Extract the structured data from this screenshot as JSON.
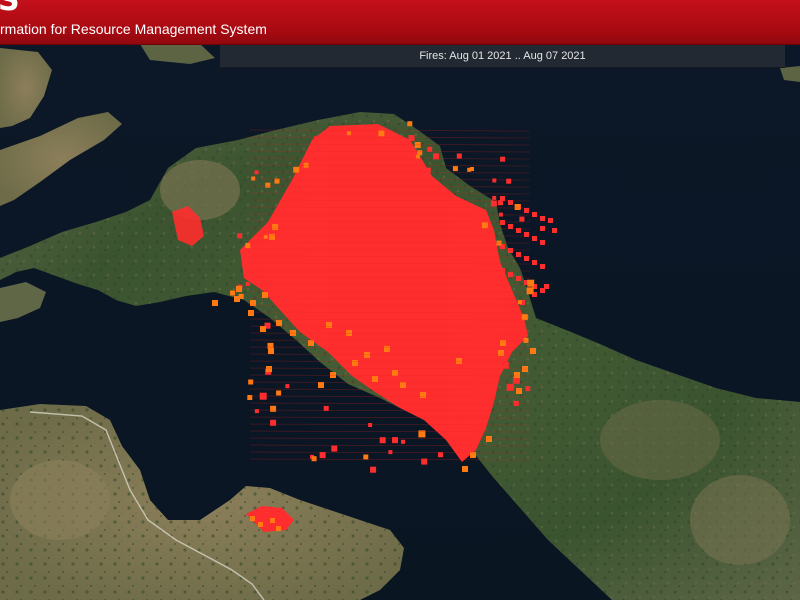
{
  "header": {
    "logo_fragment": "S",
    "subtitle": "rmation for Resource Management System"
  },
  "map": {
    "date_range_label": "Fires: Aug 01 2021 .. Aug 07 2021"
  },
  "colors": {
    "header_red": "#b50c16",
    "fire_red": "#ff2e2e",
    "fire_orange": "#ff7a12",
    "sea": "#0d1a2b",
    "land_green": "#3d5a33",
    "land_tan": "#8a7d59"
  }
}
